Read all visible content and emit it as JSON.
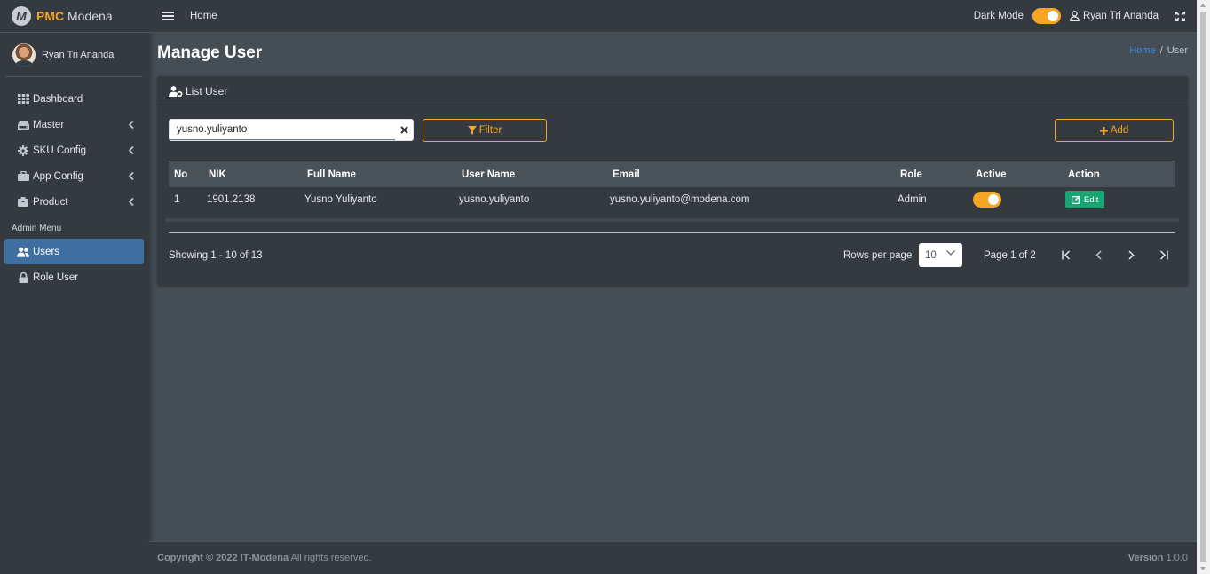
{
  "brand": {
    "prefix": "PMC",
    "name": "Modena",
    "logo_letter": "M"
  },
  "sidebar": {
    "user_name": "Ryan Tri Ananda",
    "items": [
      {
        "label": "Dashboard",
        "icon": "grid-icon"
      },
      {
        "label": "Master",
        "icon": "hdd-icon"
      },
      {
        "label": "SKU Config",
        "icon": "gear-icon"
      },
      {
        "label": "App Config",
        "icon": "toolbox-icon"
      },
      {
        "label": "Product",
        "icon": "box-icon"
      }
    ],
    "admin_header": "Admin Menu",
    "admin_items": [
      {
        "label": "Users",
        "icon": "users-icon",
        "active": true
      },
      {
        "label": "Role User",
        "icon": "lock-icon",
        "active": false
      }
    ]
  },
  "topbar": {
    "home": "Home",
    "dark_mode_label": "Dark Mode",
    "dark_mode_on": true,
    "user_name": "Ryan Tri Ananda"
  },
  "page": {
    "title": "Manage User",
    "breadcrumb": {
      "home": "Home",
      "sep": "/",
      "current": "User"
    }
  },
  "card": {
    "title": "List User",
    "search_value": "yusno.yuliyanto",
    "filter_label": "Filter",
    "add_label": "Add",
    "columns": {
      "no": "No",
      "nik": "NIK",
      "full_name": "Full Name",
      "user_name": "User Name",
      "email": "Email",
      "role": "Role",
      "active": "Active",
      "action": "Action"
    },
    "rows": [
      {
        "no": "1",
        "nik": "1901.2138",
        "full_name": "Yusno Yuliyanto",
        "user_name": "yusno.yuliyanto",
        "email": "yusno.yuliyanto@modena.com",
        "role": "Admin",
        "active": true,
        "action_label": "Edit"
      }
    ],
    "showing": "Showing 1 - 10 of 13",
    "rows_per_page_label": "Rows per page",
    "rows_per_page_value": "10",
    "page_label": "Page 1 of 2"
  },
  "footer": {
    "copyright_bold": "Copyright © 2022 IT-Modena",
    "copyright_rest": " All rights reserved.",
    "version_label": "Version",
    "version_value": " 1.0.0"
  },
  "colors": {
    "accent": "#f5a623",
    "active_nav": "#3f6fa0",
    "edit_button": "#17a673",
    "link": "#3b8de8"
  }
}
